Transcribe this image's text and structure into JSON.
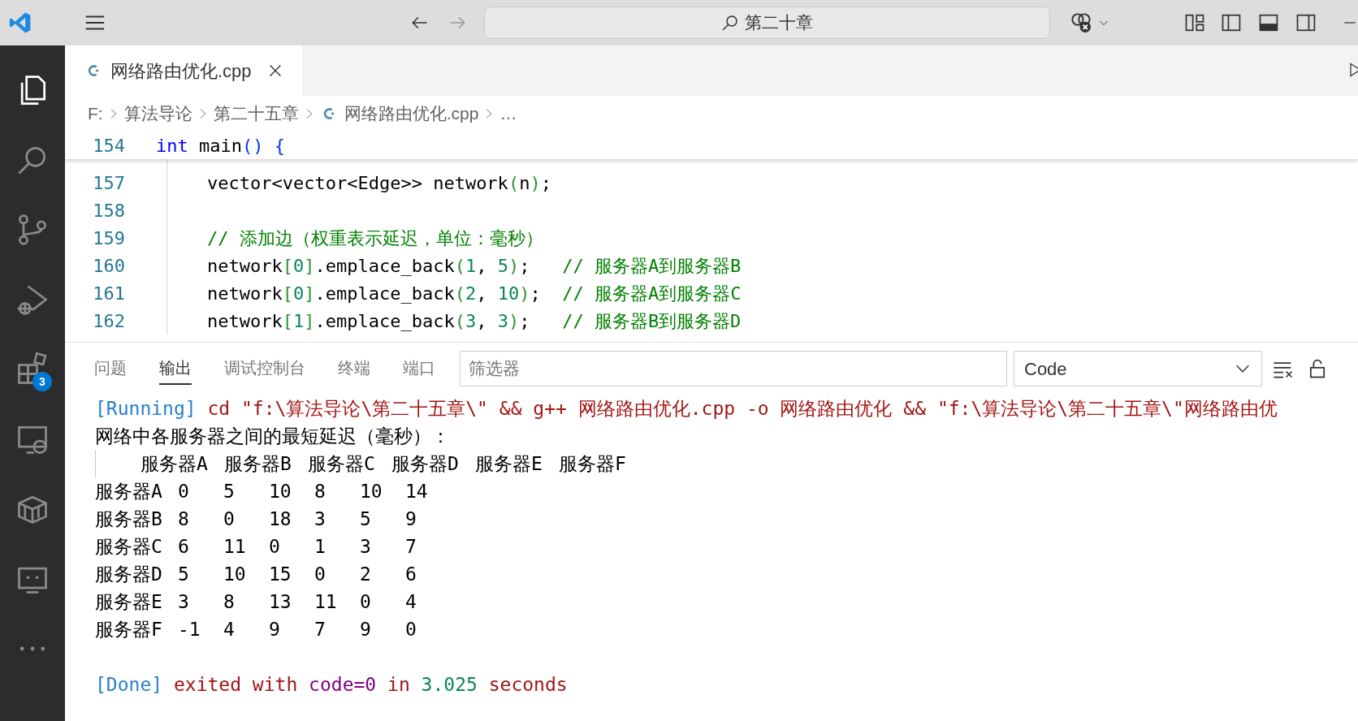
{
  "title_bar": {
    "command_center": "第二十章"
  },
  "activity_bar": {
    "items": [
      {
        "kind": "explorer",
        "selected": true
      },
      {
        "kind": "search",
        "selected": false
      },
      {
        "kind": "source-control",
        "selected": false
      },
      {
        "kind": "run-debug",
        "selected": false
      },
      {
        "kind": "extensions",
        "selected": false,
        "badge": "3"
      },
      {
        "kind": "remote",
        "selected": false
      },
      {
        "kind": "package",
        "selected": false
      },
      {
        "kind": "chat",
        "selected": false
      },
      {
        "kind": "more",
        "selected": false
      }
    ]
  },
  "tabs": [
    {
      "label": "网络路由优化.cpp",
      "selected": true
    }
  ],
  "breadcrumb": [
    {
      "kind": "folder",
      "text": "F:"
    },
    {
      "kind": "folder",
      "text": "算法导论"
    },
    {
      "kind": "folder",
      "text": "第二十五章"
    },
    {
      "kind": "file",
      "text": "网络路由优化.cpp"
    },
    {
      "kind": "folder",
      "text": "…"
    }
  ],
  "editor": {
    "sticky_line": {
      "number": "154",
      "tokens": [
        {
          "text": "int",
          "color": "#0000ff"
        },
        {
          "text": " main",
          "color": "#000000"
        },
        {
          "text": "()",
          "color": "#0431fa"
        },
        {
          "text": " {",
          "color": "#0431fa"
        }
      ]
    },
    "lines": [
      {
        "number": "157",
        "tokens": [
          {
            "text": "vector<vector<Edge>> network",
            "color": "#000000"
          },
          {
            "text": "(",
            "color": "#319331"
          },
          {
            "text": "n",
            "color": "#000000"
          },
          {
            "text": ")",
            "color": "#319331"
          },
          {
            "text": ";",
            "color": "#000000"
          }
        ]
      },
      {
        "number": "158"
      },
      {
        "number": "159",
        "tokens": [
          {
            "text": "// 添加边（权重表示延迟，单位：毫秒）",
            "color": "#008000"
          }
        ]
      },
      {
        "number": "160",
        "tokens": [
          {
            "text": "network",
            "color": "#000000"
          },
          {
            "text": "[",
            "color": "#319331"
          },
          {
            "text": "0",
            "color": "#098658"
          },
          {
            "text": "]",
            "color": "#319331"
          },
          {
            "text": ".emplace_back",
            "color": "#000000"
          },
          {
            "text": "(",
            "color": "#319331"
          },
          {
            "text": "1",
            "color": "#098658"
          },
          {
            "text": ", ",
            "color": "#000000"
          },
          {
            "text": "5",
            "color": "#098658"
          },
          {
            "text": ")",
            "color": "#319331"
          },
          {
            "text": ";   ",
            "color": "#000000"
          },
          {
            "text": "// 服务器A到服务器B",
            "color": "#008000"
          }
        ]
      },
      {
        "number": "161",
        "tokens": [
          {
            "text": "network",
            "color": "#000000"
          },
          {
            "text": "[",
            "color": "#319331"
          },
          {
            "text": "0",
            "color": "#098658"
          },
          {
            "text": "]",
            "color": "#319331"
          },
          {
            "text": ".emplace_back",
            "color": "#000000"
          },
          {
            "text": "(",
            "color": "#319331"
          },
          {
            "text": "2",
            "color": "#098658"
          },
          {
            "text": ", ",
            "color": "#000000"
          },
          {
            "text": "10",
            "color": "#098658"
          },
          {
            "text": ")",
            "color": "#319331"
          },
          {
            "text": ";  ",
            "color": "#000000"
          },
          {
            "text": "// 服务器A到服务器C",
            "color": "#008000"
          }
        ]
      },
      {
        "number": "162",
        "tokens": [
          {
            "text": "network",
            "color": "#000000"
          },
          {
            "text": "[",
            "color": "#319331"
          },
          {
            "text": "1",
            "color": "#098658"
          },
          {
            "text": "]",
            "color": "#319331"
          },
          {
            "text": ".emplace_back",
            "color": "#000000"
          },
          {
            "text": "(",
            "color": "#319331"
          },
          {
            "text": "3",
            "color": "#098658"
          },
          {
            "text": ", ",
            "color": "#000000"
          },
          {
            "text": "3",
            "color": "#098658"
          },
          {
            "text": ")",
            "color": "#319331"
          },
          {
            "text": ";   ",
            "color": "#000000"
          },
          {
            "text": "// 服务器B到服务器D",
            "color": "#008000"
          }
        ]
      }
    ]
  },
  "panel": {
    "tabs": [
      {
        "label": "问题",
        "selected": false
      },
      {
        "label": "输出",
        "selected": true
      },
      {
        "label": "调试控制台",
        "selected": false
      },
      {
        "label": "终端",
        "selected": false
      },
      {
        "label": "端口",
        "selected": false
      }
    ],
    "filter": {
      "placeholder": "筛选器"
    },
    "channel": "Code",
    "output": [
      {
        "kind": "text",
        "segments": [
          {
            "text": "[Running]",
            "color": "#267fcf"
          },
          {
            "text": " cd \"f:\\算法导论\\第二十五章\\\" && g++ 网络路由优化.cpp -o 网络路由优化 && \"f:\\算法导论\\第二十五章\\\"网络路由优",
            "color": "#a31515"
          }
        ]
      },
      {
        "kind": "text",
        "segments": [
          {
            "text": "网络中各服务器之间的最短延迟（毫秒）：",
            "color": "#000000"
          }
        ]
      },
      {
        "kind": "header",
        "cells": [
          "服务器A",
          "服务器B",
          "服务器C",
          "服务器D",
          "服务器E",
          "服务器F"
        ]
      },
      {
        "kind": "row",
        "label": "服务器A",
        "cells": [
          "0",
          "5",
          "10",
          "8",
          "10",
          "14"
        ]
      },
      {
        "kind": "row",
        "label": "服务器B",
        "cells": [
          "8",
          "0",
          "18",
          "3",
          "5",
          "9"
        ]
      },
      {
        "kind": "row",
        "label": "服务器C",
        "cells": [
          "6",
          "11",
          "0",
          "1",
          "3",
          "7"
        ]
      },
      {
        "kind": "row",
        "label": "服务器D",
        "cells": [
          "5",
          "10",
          "15",
          "0",
          "2",
          "6"
        ]
      },
      {
        "kind": "row",
        "label": "服务器E",
        "cells": [
          "3",
          "8",
          "13",
          "11",
          "0",
          "4"
        ]
      },
      {
        "kind": "row",
        "label": "服务器F",
        "cells": [
          "-1",
          "4",
          "9",
          "7",
          "9",
          "0"
        ]
      },
      {
        "kind": "summary",
        "segments": [
          {
            "text": "[Done]",
            "color": "#267fcf"
          },
          {
            "text": " exited with ",
            "color": "#a31515"
          },
          {
            "text": "code=0",
            "color": "#800080"
          },
          {
            "text": " in ",
            "color": "#a31515"
          },
          {
            "text": "3.025",
            "color": "#098658"
          },
          {
            "text": " seconds",
            "color": "#a31515"
          }
        ]
      }
    ]
  }
}
